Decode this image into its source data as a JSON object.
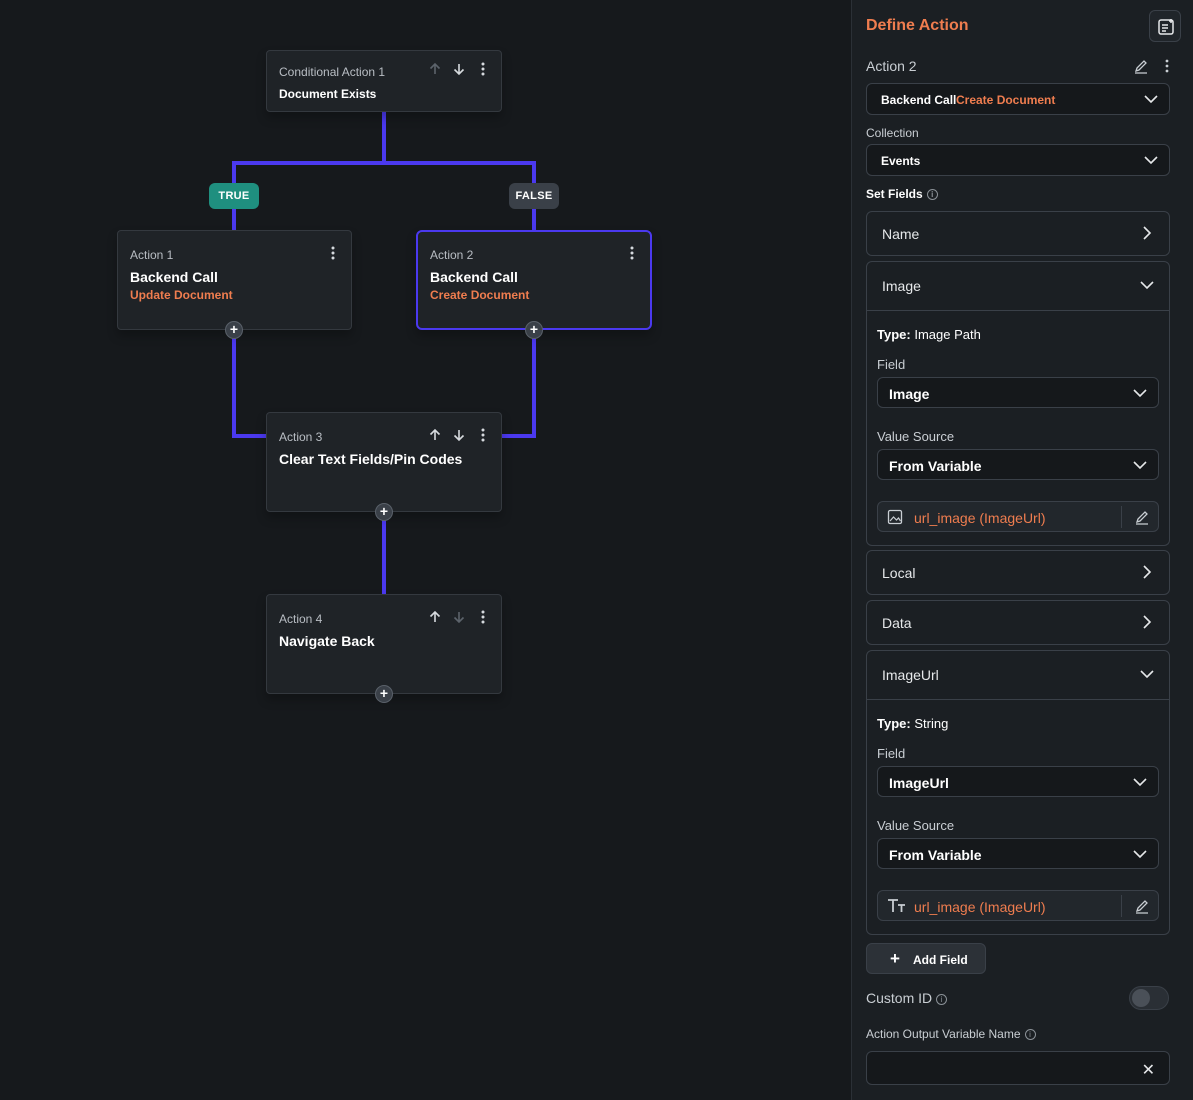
{
  "flow": {
    "conditional": {
      "label": "Conditional Action 1",
      "title": "Document Exists"
    },
    "branches": {
      "true_label": "TRUE",
      "false_label": "FALSE"
    },
    "actions": [
      {
        "label": "Action 1",
        "title": "Backend Call",
        "subtitle": "Update Document"
      },
      {
        "label": "Action 2",
        "title": "Backend Call",
        "subtitle": "Create Document"
      },
      {
        "label": "Action 3",
        "title": "Clear Text Fields/Pin Codes"
      },
      {
        "label": "Action 4",
        "title": "Navigate Back"
      }
    ],
    "add_glyph": "+"
  },
  "panel": {
    "title": "Define Action",
    "action_name": "Action 2",
    "action_type": {
      "primary": "Backend Call",
      "secondary": "Create Document"
    },
    "collection": {
      "label": "Collection",
      "value": "Events"
    },
    "set_fields_label": "Set Fields",
    "fields": [
      {
        "name": "Name"
      },
      {
        "name": "Image",
        "type_prefix": "Type:",
        "type_value": "Image Path",
        "field_label": "Field",
        "field_value": "Image",
        "source_label": "Value Source",
        "source_value": "From Variable",
        "variable": "url_image (ImageUrl)"
      },
      {
        "name": "Local"
      },
      {
        "name": "Data"
      },
      {
        "name": "ImageUrl",
        "type_prefix": "Type:",
        "type_value": "String",
        "field_label": "Field",
        "field_value": "ImageUrl",
        "source_label": "Value Source",
        "source_value": "From Variable",
        "variable": "url_image (ImageUrl)"
      }
    ],
    "add_field_label": "Add Field",
    "add_field_glyph": "+",
    "custom_id_label": "Custom ID",
    "custom_id_enabled": false,
    "output_var_label": "Action Output Variable Name",
    "output_var_value": "",
    "clear_glyph": "✕",
    "info_glyph": "i"
  },
  "colors": {
    "accent": "#ef7d4f",
    "connector": "#4b39ef",
    "true_badge": "#1f8f7f",
    "false_badge": "#3a4048"
  }
}
